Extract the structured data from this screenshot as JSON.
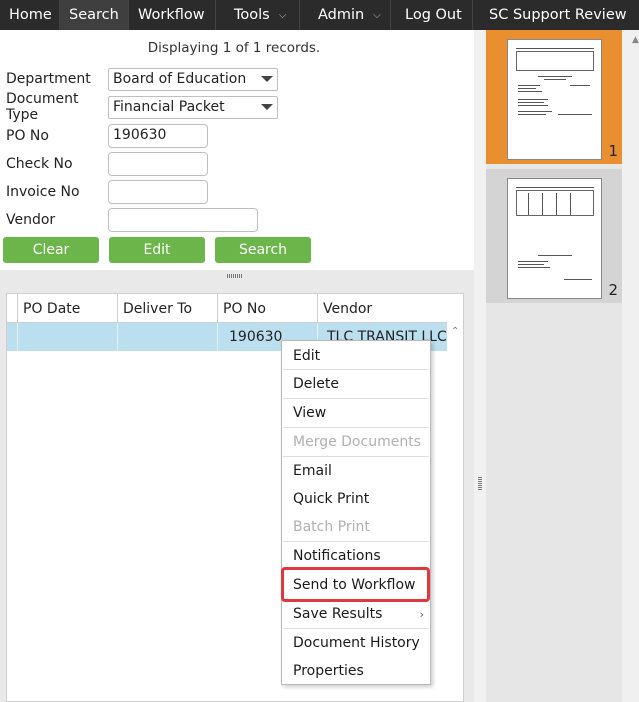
{
  "nav": {
    "home": "Home",
    "search": "Search",
    "workflow": "Workflow",
    "tools": "Tools",
    "admin": "Admin",
    "logout": "Log Out",
    "support": "SC Support Review",
    "dropdown_glyph": "⌵"
  },
  "search": {
    "displaying": "Displaying 1 of 1 records.",
    "department_label": "Department",
    "department_value": "Board of Education",
    "doctype_label": "Document Type",
    "doctype_value": "Financial Packet",
    "po_label": "PO No",
    "po_value": "190630",
    "check_label": "Check No",
    "check_value": "",
    "invoice_label": "Invoice No",
    "invoice_value": "",
    "vendor_label": "Vendor",
    "vendor_value": "",
    "clear_label": "Clear",
    "edit_label": "Edit",
    "search_label": "Search"
  },
  "grid": {
    "columns": [
      "PO Date",
      "Deliver To",
      "PO No",
      "Vendor"
    ],
    "rows": [
      {
        "po_date": "",
        "deliver_to": "",
        "po_no": "190630",
        "vendor": "TLC TRANSIT LLC"
      }
    ]
  },
  "thumbnails": [
    {
      "page": "1",
      "selected": true
    },
    {
      "page": "2",
      "selected": false
    }
  ],
  "context_menu": {
    "items": [
      {
        "label": "Edit",
        "enabled": true
      },
      {
        "label": "Delete",
        "enabled": true
      },
      {
        "label": "View",
        "enabled": true
      },
      {
        "label": "Merge Documents",
        "enabled": false
      },
      {
        "label": "Email",
        "enabled": true
      },
      {
        "label": "Quick Print",
        "enabled": true
      },
      {
        "label": "Batch Print",
        "enabled": false
      },
      {
        "label": "Notifications",
        "enabled": true
      },
      {
        "label": "Send to Workflow",
        "enabled": true,
        "highlighted": true
      },
      {
        "label": "Save Results",
        "enabled": true,
        "submenu": true
      },
      {
        "label": "Document History",
        "enabled": true
      },
      {
        "label": "Properties",
        "enabled": true
      }
    ]
  },
  "colors": {
    "nav_bg": "#2b2b2b",
    "button_green": "#6bb54a",
    "row_selected": "#bcdff0",
    "thumb_selected": "#e98f30",
    "highlight_red": "#e0383e"
  }
}
